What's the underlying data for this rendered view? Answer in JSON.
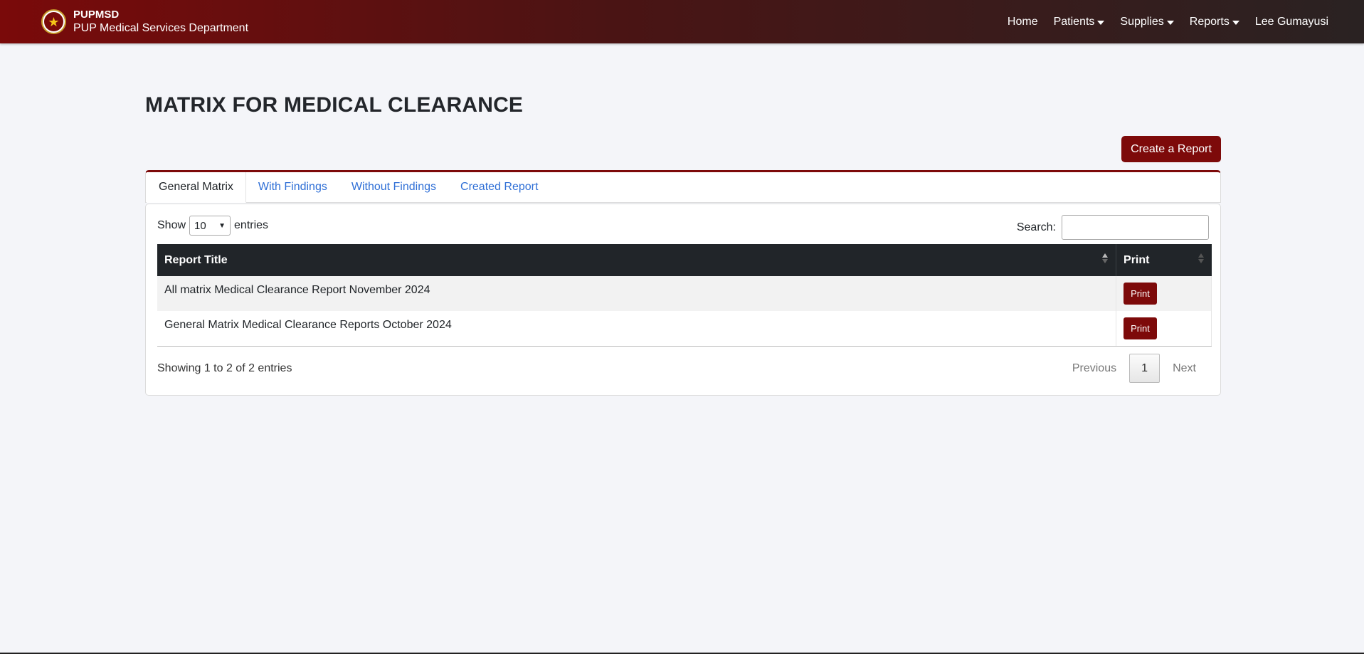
{
  "navbar": {
    "brand_short": "PUPMSD",
    "brand_long": "PUP Medical Services Department",
    "links": {
      "home": "Home",
      "patients": "Patients",
      "supplies": "Supplies",
      "reports": "Reports",
      "user": "Lee Gumayusi"
    }
  },
  "page": {
    "title": "MATRIX FOR MEDICAL CLEARANCE",
    "create_button": "Create a Report"
  },
  "tabs": [
    {
      "label": "General Matrix",
      "active": true
    },
    {
      "label": "With Findings",
      "active": false
    },
    {
      "label": "Without Findings",
      "active": false
    },
    {
      "label": "Created Report",
      "active": false
    }
  ],
  "table_controls": {
    "show_label": "Show",
    "entries_value": "10",
    "entries_label": "entries",
    "search_label": "Search:"
  },
  "table": {
    "headers": [
      "Report Title",
      "Print"
    ],
    "rows": [
      {
        "title": "All matrix Medical Clearance Report November 2024",
        "action": "Print"
      },
      {
        "title": "General Matrix Medical Clearance Reports October 2024",
        "action": "Print"
      }
    ]
  },
  "footer": {
    "info": "Showing 1 to 2 of 2 entries",
    "previous": "Previous",
    "page": "1",
    "next": "Next"
  },
  "colors": {
    "brand": "#7d0a0a",
    "table_header": "#212529",
    "link": "#2f6fd6"
  },
  "icons": {
    "logo": "pup-seal-icon",
    "caret": "caret-down-icon",
    "sort": "sort-icon"
  }
}
